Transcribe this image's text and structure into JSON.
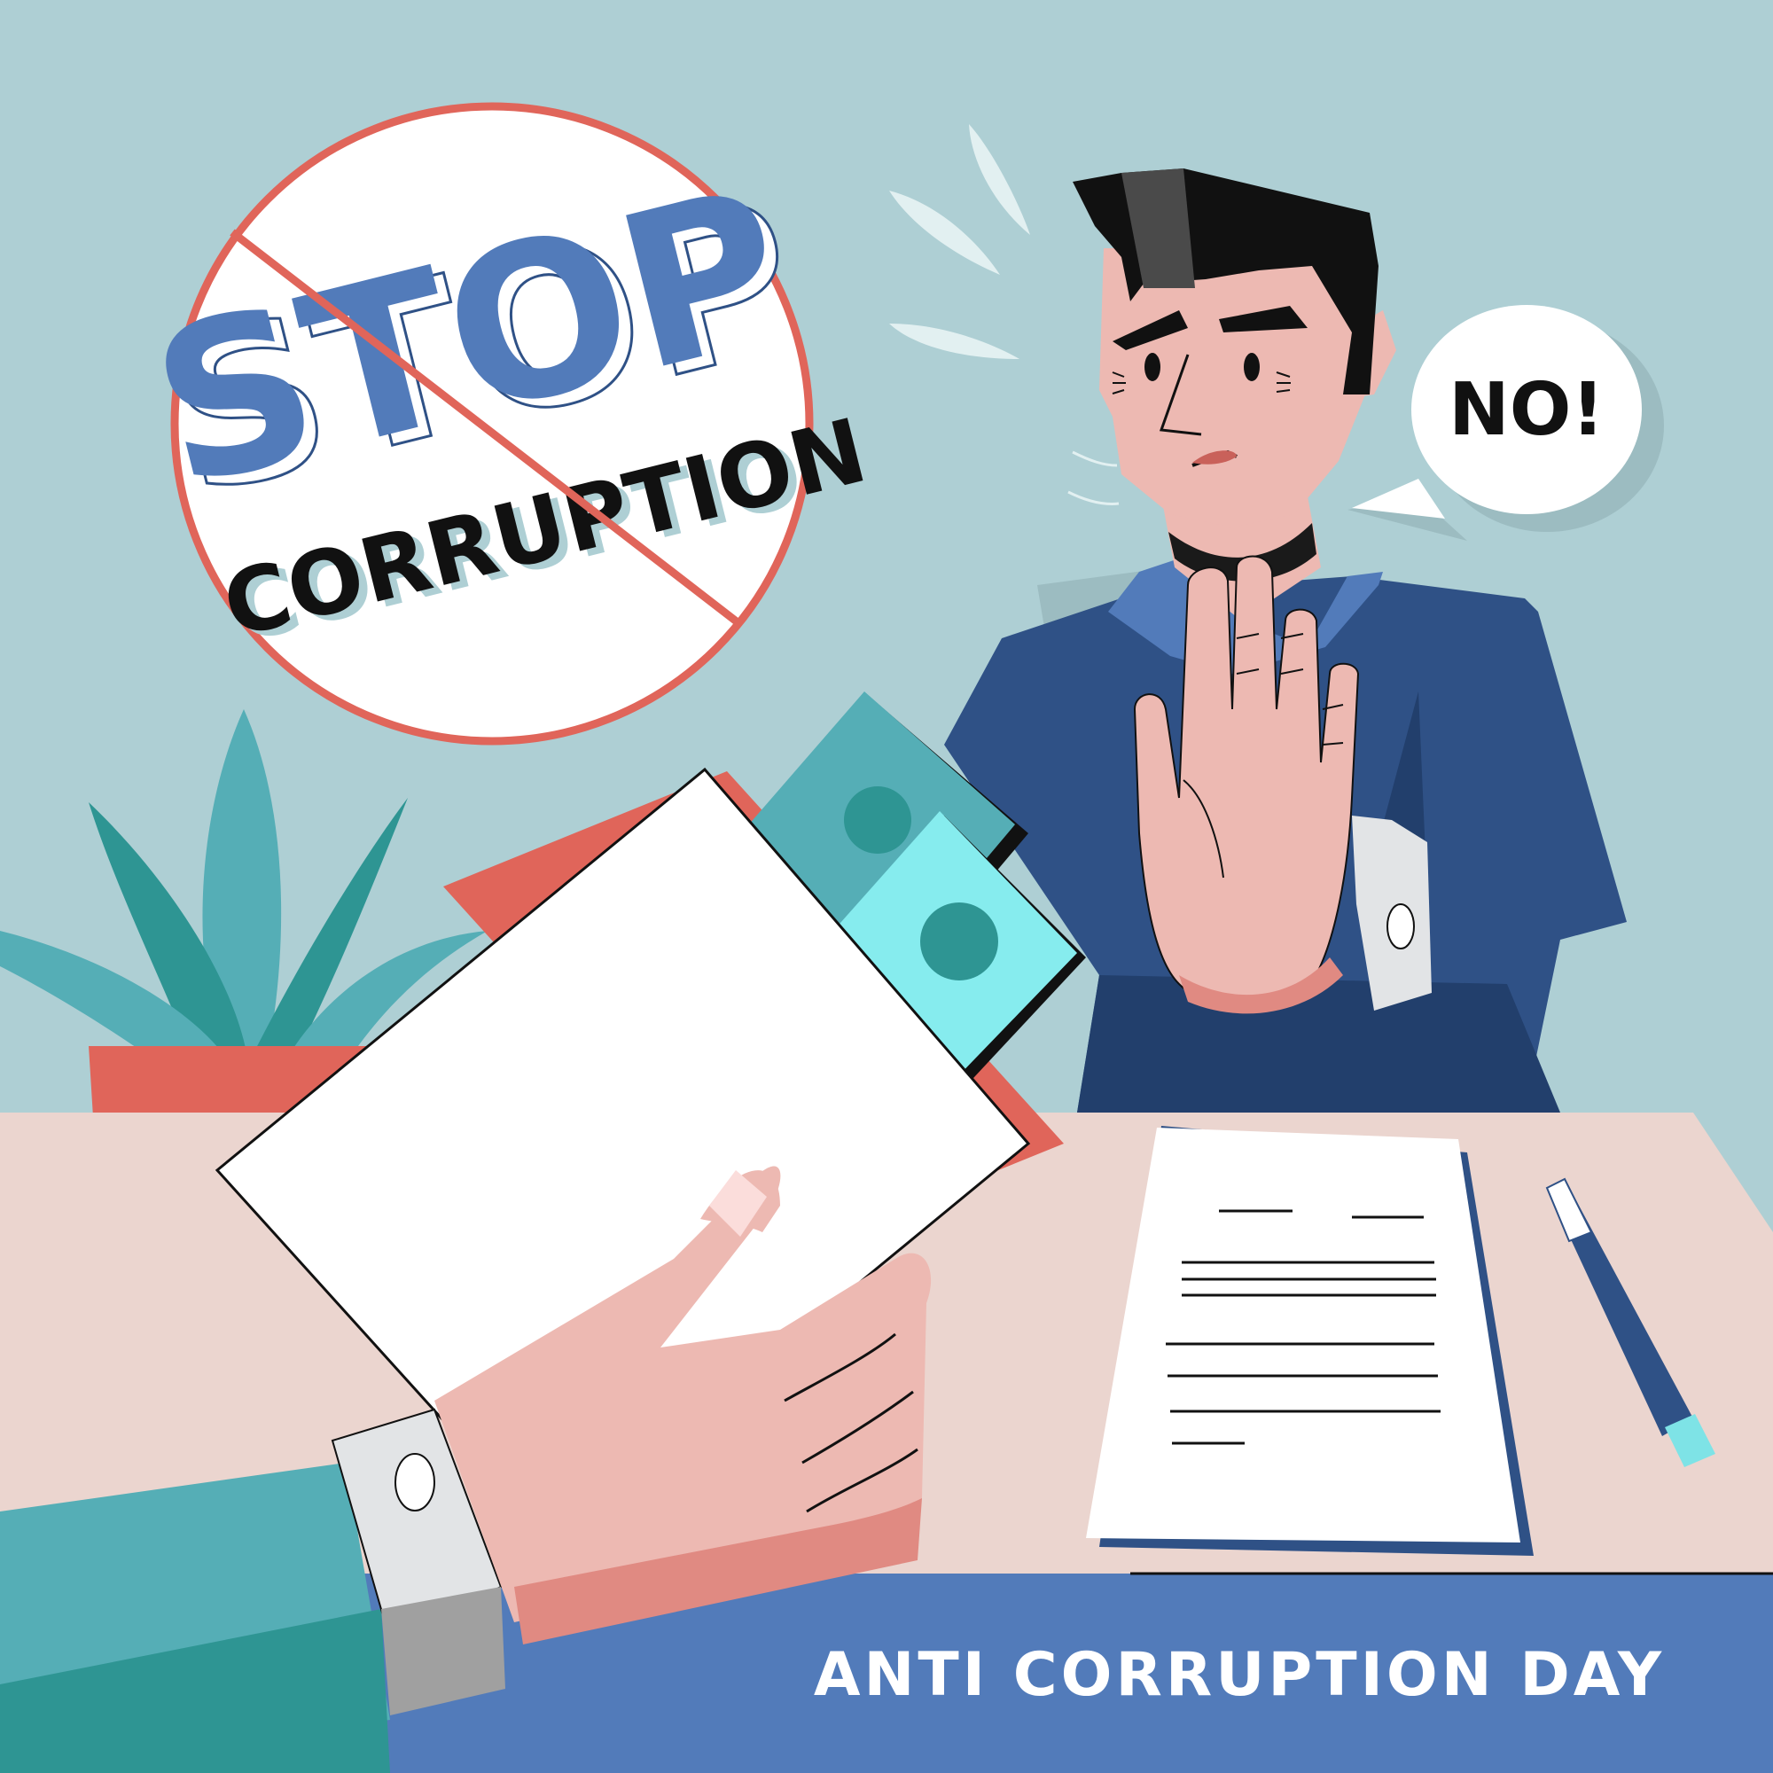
{
  "badge": {
    "title": "STOP",
    "subtitle": "CORRUPTION"
  },
  "speech_bubble": {
    "text": "NO!"
  },
  "footer": {
    "text": "ANTI CORRUPTION DAY"
  },
  "colors": {
    "background": "#aecfd4",
    "accent_blue": "#527bba",
    "accent_red": "#e0655a",
    "suit_dark": "#2f5186",
    "teal": "#55aeb6",
    "skin": "#edb9b2",
    "desk": "#ebd5cf"
  }
}
